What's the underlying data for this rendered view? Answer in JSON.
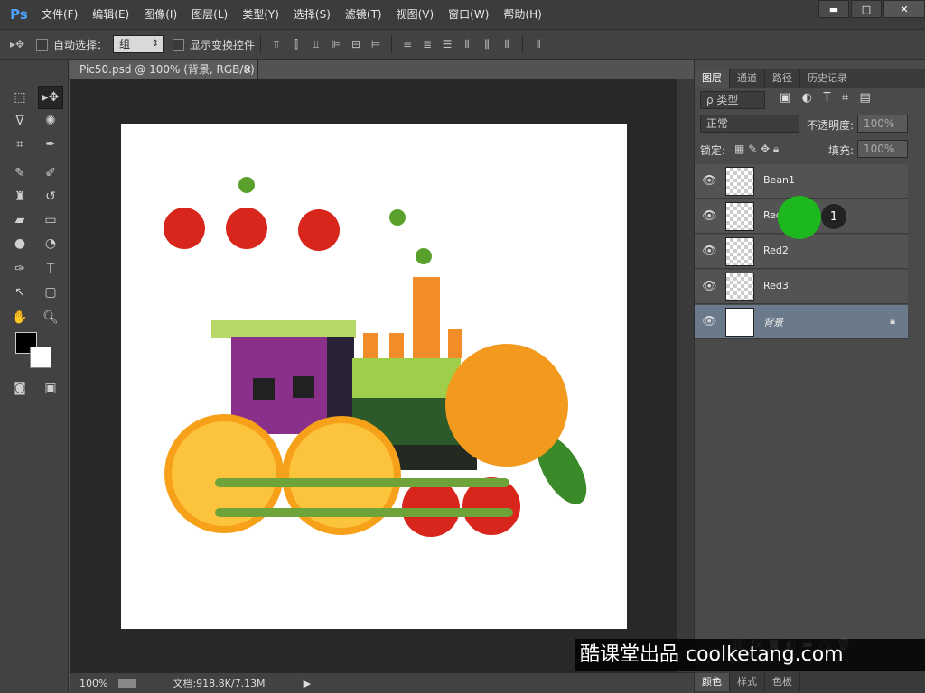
{
  "app": {
    "logo": "Ps",
    "brand_color": "#4da3ff"
  },
  "menu": [
    "文件(F)",
    "编辑(E)",
    "图像(I)",
    "图层(L)",
    "类型(Y)",
    "选择(S)",
    "滤镜(T)",
    "视图(V)",
    "窗口(W)",
    "帮助(H)"
  ],
  "window_controls": {
    "minimize": "▬",
    "maximize": "□",
    "close": "✕"
  },
  "options": {
    "auto_select_label": "自动选择：",
    "auto_select_value": "组",
    "show_transform_label": "显示变换控件"
  },
  "document": {
    "tab_title": "Pic50.psd @ 100% (背景, RGB/8)",
    "tab_close": "×",
    "zoom": "100%",
    "doc_info": "文档:918.8K/7.13M"
  },
  "panel": {
    "tabs": [
      "图层",
      "通道",
      "路径",
      "历史记录"
    ],
    "filter_kind": "ρ 类型",
    "blend_mode": "正常",
    "opacity_label": "不透明度:",
    "opacity_value": "100%",
    "lock_label": "锁定:",
    "fill_label": "填充:",
    "fill_value": "100%",
    "layers": [
      {
        "name": "Bean1",
        "selected": false
      },
      {
        "name": "Red1",
        "selected": false
      },
      {
        "name": "Red2",
        "selected": false
      },
      {
        "name": "Red3",
        "selected": false
      },
      {
        "name": "背景",
        "selected": true
      }
    ],
    "bottom_tabs": [
      "颜色",
      "样式",
      "色板"
    ]
  },
  "overlay": {
    "step_number": "1",
    "watermark": "酷课堂出品 coolketang.com",
    "cursor_color": "#1db81d"
  }
}
